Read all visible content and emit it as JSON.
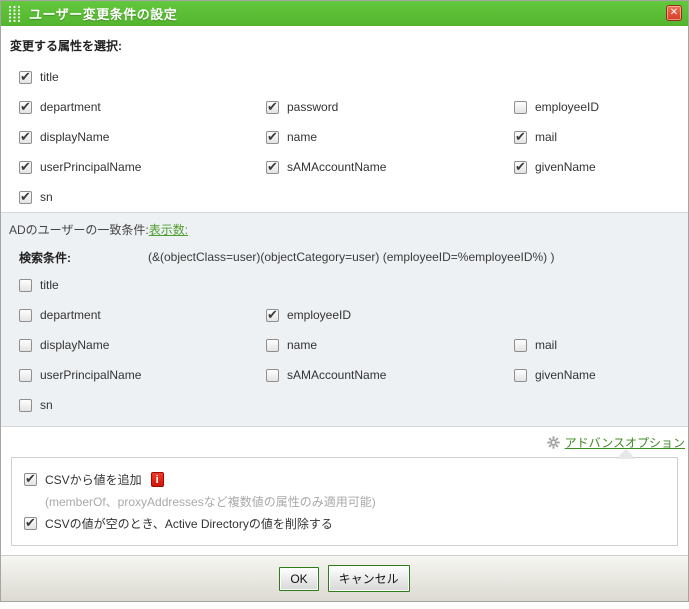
{
  "dialog": {
    "title": "ユーザー変更条件の設定"
  },
  "icons": {
    "close_glyph": "✕",
    "info_glyph": "i"
  },
  "attributes_section": {
    "heading": "変更する属性を選択:",
    "checkboxes": [
      {
        "label": "title",
        "checked": true
      },
      {
        "label": "department",
        "checked": true
      },
      {
        "label": "password",
        "checked": true
      },
      {
        "label": "employeeID",
        "checked": false
      },
      {
        "label": "displayName",
        "checked": true
      },
      {
        "label": "name",
        "checked": true
      },
      {
        "label": "mail",
        "checked": true
      },
      {
        "label": "userPrincipalName",
        "checked": true
      },
      {
        "label": "sAMAccountName",
        "checked": true
      },
      {
        "label": "givenName",
        "checked": true
      },
      {
        "label": "sn",
        "checked": true
      }
    ]
  },
  "match_section": {
    "label": "ADのユーザーの一致条件:",
    "display_count_link": "表示数:",
    "search_label": "検索条件:",
    "search_filter": "(&(objectClass=user)(objectCategory=user) (employeeID=%employeeID%) )",
    "checkboxes": [
      {
        "label": "title",
        "checked": false
      },
      {
        "label": "department",
        "checked": false
      },
      {
        "label": "employeeID",
        "checked": true
      },
      {
        "label": "displayName",
        "checked": false
      },
      {
        "label": "name",
        "checked": false
      },
      {
        "label": "mail",
        "checked": false
      },
      {
        "label": "userPrincipalName",
        "checked": false
      },
      {
        "label": "sAMAccountName",
        "checked": false
      },
      {
        "label": "givenName",
        "checked": false
      },
      {
        "label": "sn",
        "checked": false
      }
    ]
  },
  "advanced": {
    "link_label": "アドバンスオプション"
  },
  "csv_section": {
    "add_value_label": "CSVから値を追加",
    "add_value_checked": true,
    "note": "(memberOf、proxyAddressesなど複数値の属性のみ適用可能)",
    "delete_empty_label": "CSVの値が空のとき、Active Directoryの値を削除する",
    "delete_empty_checked": true
  },
  "footer": {
    "ok_label": "OK",
    "cancel_label": "キャンセル"
  },
  "colors": {
    "titlebar_green": "#5bbf36",
    "link_green": "#4f9d2f",
    "close_red": "#d43c21",
    "info_red": "#e01507",
    "match_section_bg": "#eef1f4"
  }
}
